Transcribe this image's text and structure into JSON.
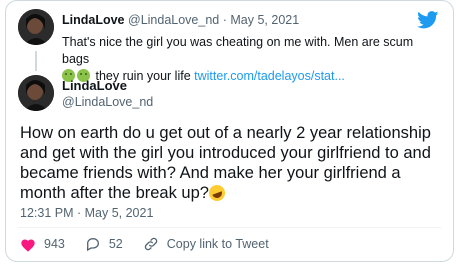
{
  "quoted": {
    "name": "LindaLove",
    "handle": "@LindaLove_nd",
    "date": "May 5, 2021",
    "separator": "·",
    "text_start": "That's nice the girl you was cheating on me with. Men are scum bags",
    "text_end": " they ruin your life ",
    "link": "twitter.com/tadelayos/stat...",
    "emojis": [
      "nauseated-face",
      "nauseated-face"
    ]
  },
  "tweet": {
    "name": "LindaLove",
    "handle": "@LindaLove_nd",
    "text": "How on earth do u get out of a nearly 2 year relationship and get with the girl you introduced your girlfriend to and became friends with? And make her your girlfriend a month after the break up?",
    "emoji": "rolling-on-the-floor-laughing",
    "timestamp": "12:31 PM · May 5, 2021"
  },
  "actions": {
    "likes": "943",
    "replies": "52",
    "copy_link": "Copy link to Tweet"
  },
  "colors": {
    "accent": "#1d9bf0",
    "text": "#0f1419",
    "muted": "#536471",
    "border": "#cfd9de"
  },
  "icons": [
    "twitter-bird-icon",
    "heart-icon",
    "reply-icon",
    "link-icon"
  ]
}
